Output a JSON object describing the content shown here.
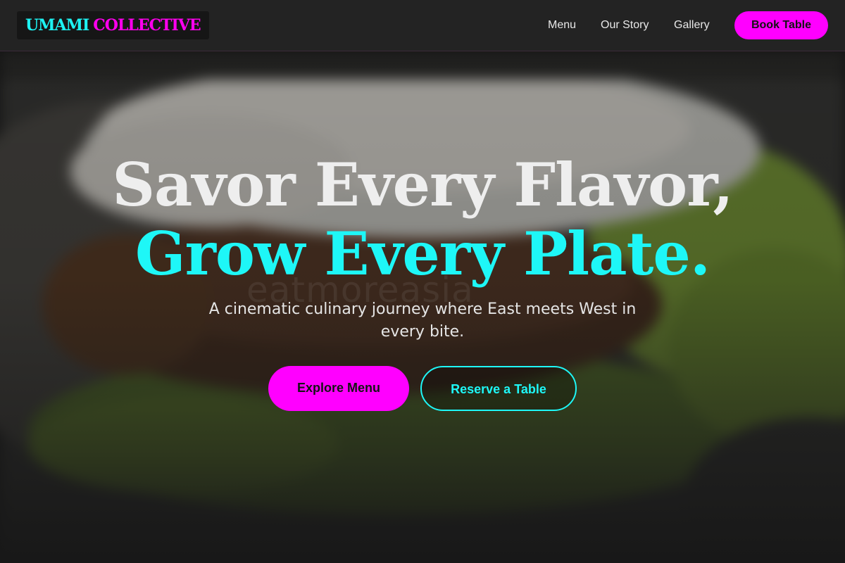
{
  "brand": {
    "part1": "UMAMI",
    "part2": "COLLECTIVE",
    "colors": {
      "cyan": "#1ef2f2",
      "magenta": "#ff00ff"
    }
  },
  "nav": {
    "links": [
      {
        "label": "Menu"
      },
      {
        "label": "Our Story"
      },
      {
        "label": "Gallery"
      }
    ],
    "cta_label": "Book Table"
  },
  "hero": {
    "headline_line1": "Savor Every Flavor,",
    "headline_line2": "Grow Every Plate.",
    "subtitle": "A cinematic culinary journey where East meets West in every bite.",
    "primary_button": "Explore Menu",
    "secondary_button": "Reserve a Table",
    "image_watermark": "eatmoreasia",
    "image_subject": "blurred bao bun with grilled meat and lettuce"
  }
}
